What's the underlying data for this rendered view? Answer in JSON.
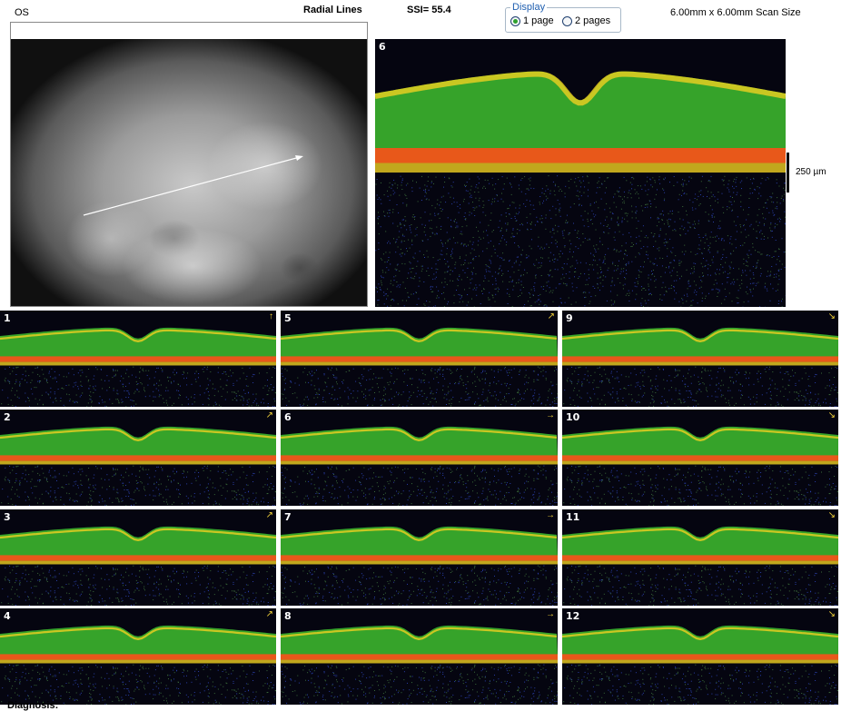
{
  "header": {
    "eye": "OS",
    "title": "Radial Lines",
    "ssi": "SSI= 55.4",
    "scan_size": "6.00mm x 6.00mm Scan Size"
  },
  "display": {
    "legend": "Display",
    "options": [
      {
        "label": "1 page",
        "selected": true
      },
      {
        "label": "2 pages",
        "selected": false
      }
    ]
  },
  "main_scan": {
    "number": "6"
  },
  "scale": {
    "label": "250 µm"
  },
  "scans": [
    {
      "number": "1",
      "arrow": "↑"
    },
    {
      "number": "5",
      "arrow": "↗"
    },
    {
      "number": "9",
      "arrow": "↘"
    },
    {
      "number": "2",
      "arrow": "↗"
    },
    {
      "number": "6",
      "arrow": "→"
    },
    {
      "number": "10",
      "arrow": "↘"
    },
    {
      "number": "3",
      "arrow": "↗"
    },
    {
      "number": "7",
      "arrow": "→"
    },
    {
      "number": "11",
      "arrow": "↘"
    },
    {
      "number": "4",
      "arrow": "↗"
    },
    {
      "number": "8",
      "arrow": "→"
    },
    {
      "number": "12",
      "arrow": "↘"
    }
  ],
  "footer": {
    "diagnosis": "Diagnosis:"
  },
  "colors": {
    "retina_green": "#3fbf2f",
    "rpe_red": "#e8581a",
    "rpe_yellow": "#f0d020",
    "noise_blue": "#2a3fa8",
    "arrow": "#ffffff"
  }
}
